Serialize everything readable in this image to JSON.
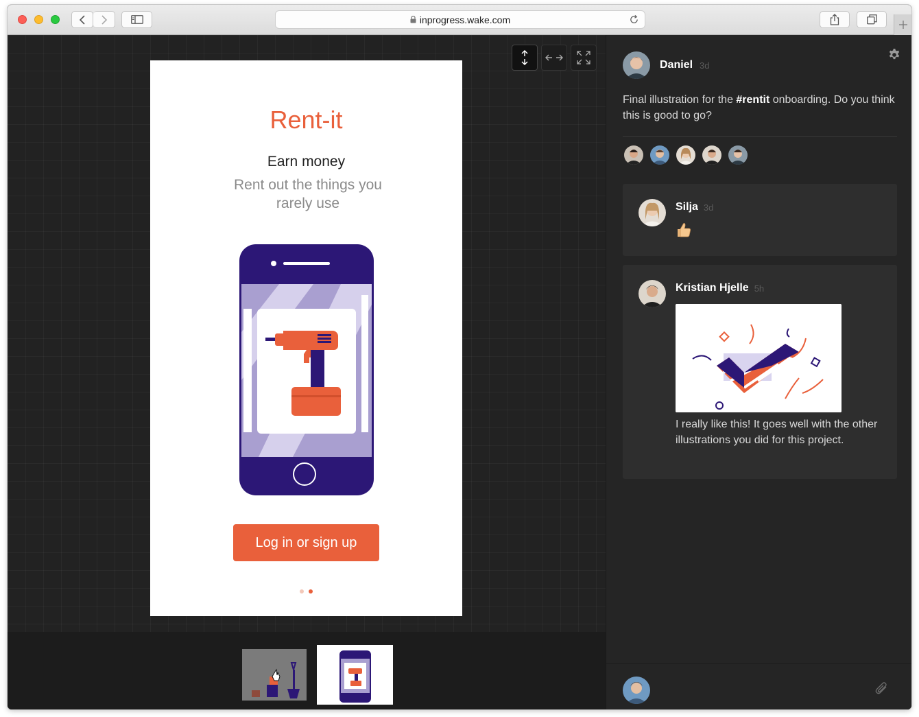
{
  "browser": {
    "url": "inprogress.wake.com"
  },
  "screen": {
    "title": "Rent-it",
    "subtitle": "Earn money",
    "description": "Rent out the things you rarely use",
    "cta": "Log in or sign up",
    "page_dots": 2,
    "active_dot": 2
  },
  "colors": {
    "accent": "#e9603b",
    "phone": "#2c1776",
    "phone_screen": "#a99fd0"
  },
  "post": {
    "author": "Daniel",
    "time": "3d",
    "text_before": "Final illustration for the ",
    "hashtag": "#rentit",
    "text_after": " onboarding. Do you think this is good to go?"
  },
  "viewers_count": 5,
  "comments": [
    {
      "author": "Silja",
      "time": "3d",
      "emoji": "thumbs-up"
    },
    {
      "author": "Kristian Hjelle",
      "time": "5h",
      "text": "I really like this! It goes well with the other illustrations you did for this project."
    }
  ],
  "icons": {
    "settings": "gear-icon",
    "attach": "paperclip-icon"
  }
}
